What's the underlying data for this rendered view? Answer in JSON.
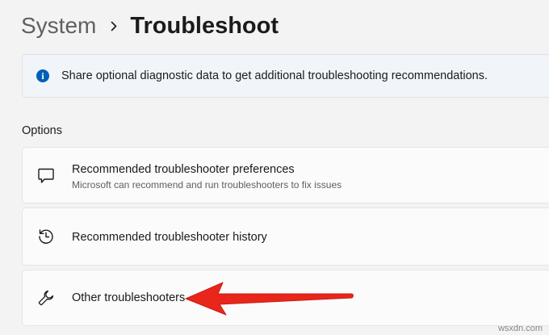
{
  "breadcrumb": {
    "parent": "System",
    "separator": "chevron-right-icon",
    "current": "Troubleshoot"
  },
  "info_bar": {
    "icon": "info-icon",
    "text": "Share optional diagnostic data to get additional troubleshooting recommendations."
  },
  "options": {
    "heading": "Options",
    "items": [
      {
        "icon": "chat-bubble-icon",
        "title": "Recommended troubleshooter preferences",
        "description": "Microsoft can recommend and run troubleshooters to fix issues"
      },
      {
        "icon": "history-icon",
        "title": "Recommended troubleshooter history"
      },
      {
        "icon": "wrench-icon",
        "title": "Other troubleshooters"
      }
    ]
  },
  "annotation": {
    "icon": "red-arrow-icon",
    "color": "#e8261b"
  },
  "watermark": "wsxdn.com",
  "colors": {
    "accent": "#005fb8",
    "background": "#f3f3f3",
    "card": "#fbfbfb"
  }
}
